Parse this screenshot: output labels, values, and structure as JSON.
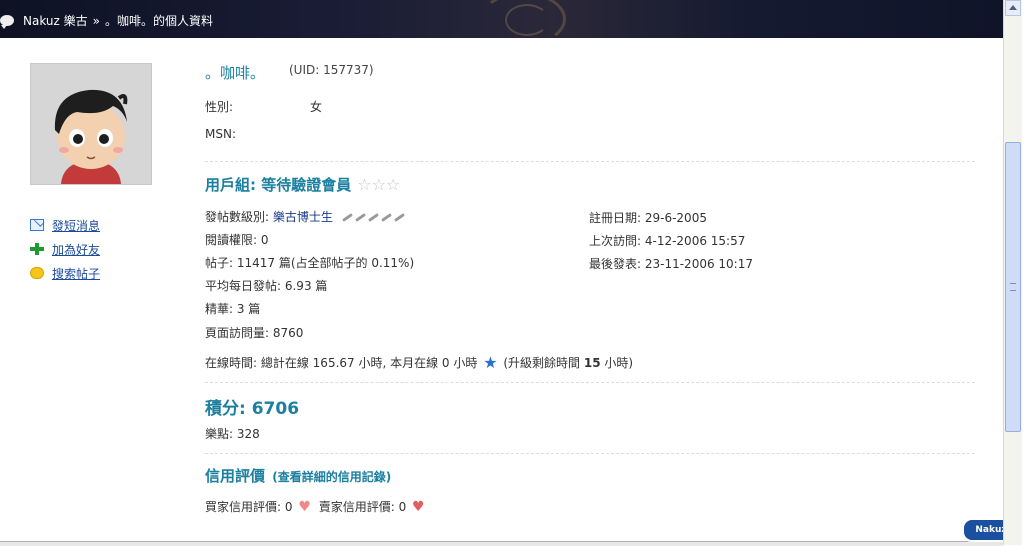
{
  "breadcrumb": {
    "site": "Nakuz 樂古",
    "separator": "»",
    "page": "。咖啡。的個人資料"
  },
  "profile": {
    "nickname": "。咖啡。",
    "uid": "(UID: 157737)",
    "gender_label": "性別:",
    "gender_value": "女",
    "msn_label": "MSN:"
  },
  "sidebar": {
    "send_message": "發短消息",
    "add_friend": "加為好友",
    "search_posts": "搜索帖子"
  },
  "group": {
    "title": "用戶組: 等待驗證會員",
    "stars": "☆☆☆"
  },
  "stats_left": {
    "level_label": "發帖數級別:",
    "level_value": "樂古博士生",
    "read_perm": "閱讀權限: 0",
    "posts": "帖子: 11417 篇(占全部帖子的 0.11%)",
    "daily": "平均每日發帖: 6.93 篇",
    "digest": "精華: 3 篇",
    "page_views": "頁面訪問量: 8760"
  },
  "stats_right": {
    "register": "註冊日期: 29-6-2005",
    "last_visit": "上次訪問: 4-12-2006 15:57",
    "last_post": "最後發表: 23-11-2006 10:17"
  },
  "online": {
    "text": "在線時間: 總計在線 165.67 小時, 本月在線 0 小時",
    "upgrade_prefix": "(升級剩餘時間",
    "upgrade_value": "15",
    "upgrade_suffix": "小時)"
  },
  "score": {
    "title": "積分: 6706",
    "points": "樂點: 328"
  },
  "credit": {
    "title": "信用評價",
    "link": "(查看詳細的信用記錄)",
    "buyer": "買家信用評價: 0",
    "seller": "賣家信用評價: 0"
  },
  "logo": {
    "text": "Nakuz"
  }
}
